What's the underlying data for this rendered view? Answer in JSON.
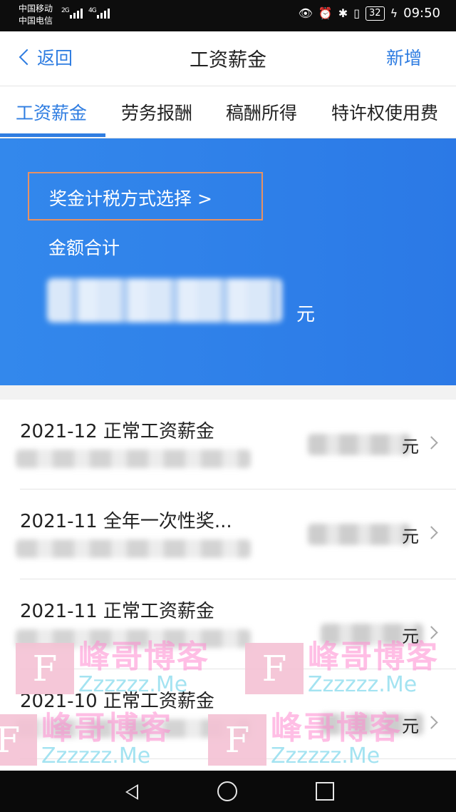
{
  "status_bar": {
    "carrier_1": "中国移动",
    "carrier_2": "中国电信",
    "sig_1": "2G",
    "sig_2": "4G",
    "battery": "32",
    "time": "09:50",
    "icons": [
      "eye-icon",
      "alarm-icon",
      "bluetooth-icon",
      "vibrate-icon",
      "battery-icon",
      "charging-icon"
    ]
  },
  "header": {
    "back_label": "返回",
    "title": "工资薪金",
    "action_label": "新增"
  },
  "tabs": [
    {
      "label": "工资薪金",
      "active": true
    },
    {
      "label": "劳务报酬",
      "active": false
    },
    {
      "label": "稿酬所得",
      "active": false
    },
    {
      "label": "特许权使用费",
      "active": false
    }
  ],
  "banner": {
    "bonus_method_label": "奖金计税方式选择 >",
    "amount_label": "金额合计",
    "amount_unit": "元",
    "accent_color": "#2f7de1",
    "highlight_color": "#e89163"
  },
  "records": [
    {
      "title": "2021-12 正常工资薪金",
      "unit": "元"
    },
    {
      "title": "2021-11 全年一次性奖...",
      "unit": "元"
    },
    {
      "title": "2021-11 正常工资薪金",
      "unit": "元"
    },
    {
      "title": "2021-10 正常工资薪金",
      "unit": "元"
    }
  ],
  "watermark": {
    "logo_letter": "F",
    "cn": "峰哥博客",
    "en": "Zzzzzz.Me"
  }
}
